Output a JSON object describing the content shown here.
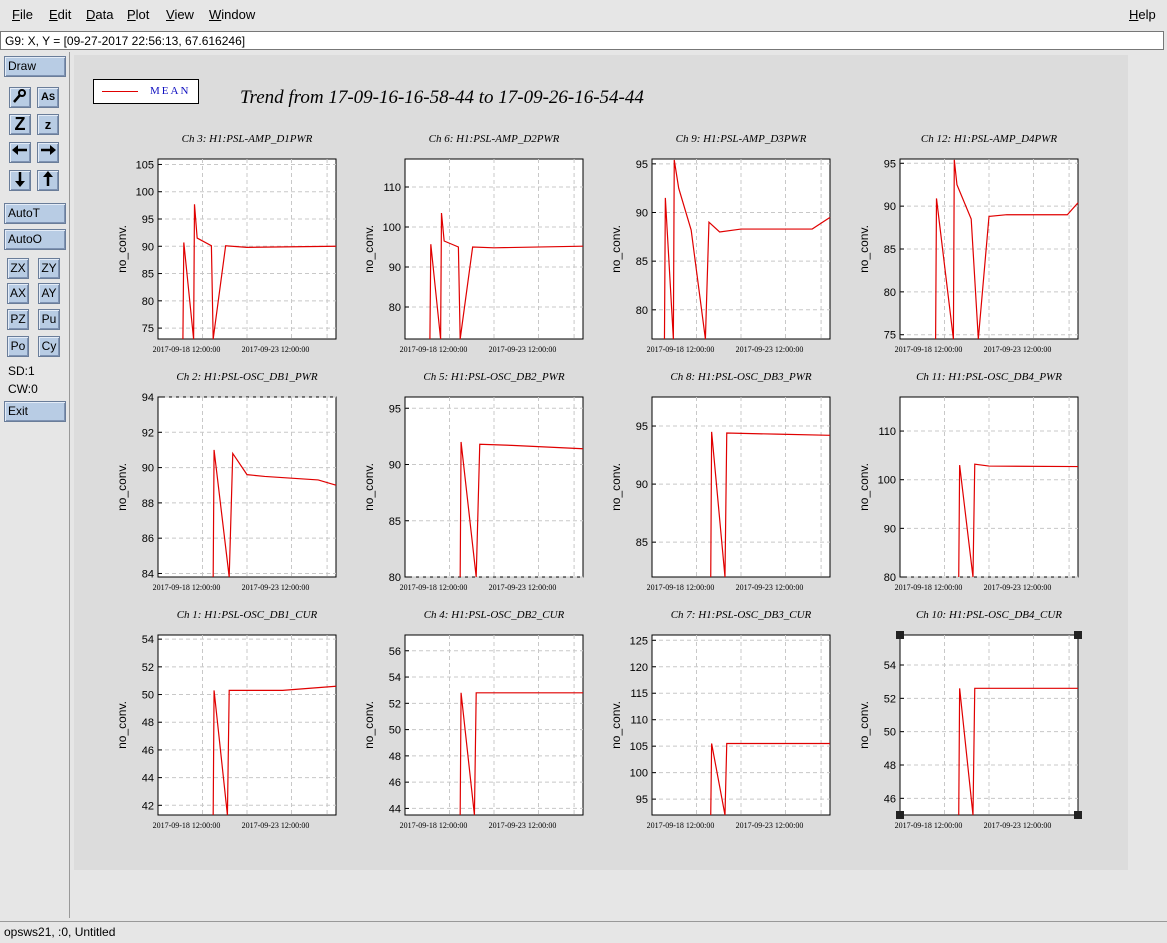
{
  "menubar": {
    "items": [
      {
        "label": "File",
        "key": "F",
        "rest": "ile",
        "name": "menu-file"
      },
      {
        "label": "Edit",
        "key": "E",
        "rest": "dit",
        "name": "menu-edit"
      },
      {
        "label": "Data",
        "key": "D",
        "rest": "ata",
        "name": "menu-data"
      },
      {
        "label": "Plot",
        "key": "P",
        "rest": "lot",
        "name": "menu-plot"
      },
      {
        "label": "View",
        "key": "V",
        "rest": "iew",
        "name": "menu-view"
      },
      {
        "label": "Window",
        "key": "W",
        "rest": "indow",
        "name": "menu-window"
      }
    ],
    "help": {
      "key": "H",
      "rest": "elp"
    }
  },
  "coord_readout": "G9: X, Y = [09-27-2017 22:56:13, 67.616246]",
  "toolbar": {
    "draw": "Draw",
    "autoT": "AutoT",
    "autoO": "AutoO",
    "pairs": [
      [
        "ZX",
        "ZY"
      ],
      [
        "AX",
        "AY"
      ],
      [
        "PZ",
        "Pu"
      ],
      [
        "Po",
        "Cy"
      ]
    ],
    "sd": "SD:1",
    "cw": "CW:0",
    "exit": "Exit",
    "icons": [
      "search-icon",
      "text-size-icon",
      "zoom-in-icon",
      "zoom-out-icon",
      "arrow-left-icon",
      "arrow-right-icon",
      "arrow-down-icon",
      "arrow-up-icon"
    ]
  },
  "legend": {
    "label": "MEAN",
    "color": "#e00000"
  },
  "trend_title": "Trend from 17-09-16-16-58-44 to 17-09-26-16-54-44",
  "status": "opsws21, :0, Untitled",
  "chart_data": [
    {
      "type": "line",
      "title": "Ch 3: H1:PSL-AMP_D1PWR",
      "ylabel": "no_conv.",
      "ylim": [
        73,
        106
      ],
      "yticks": [
        75,
        80,
        85,
        90,
        95,
        100,
        105
      ],
      "xticks": [
        "2017-09-18 12:00:00",
        "2017-09-23 12:00:00"
      ],
      "x": [
        0.14,
        0.145,
        0.2,
        0.205,
        0.22,
        0.3,
        0.31,
        0.38,
        0.5,
        1.0
      ],
      "values": [
        73,
        90.7,
        73,
        97.7,
        91.5,
        90.1,
        73,
        90.1,
        89.8,
        90.0
      ]
    },
    {
      "type": "line",
      "title": "Ch 6: H1:PSL-AMP_D2PWR",
      "ylabel": "no_conv.",
      "ylim": [
        72,
        117
      ],
      "yticks": [
        80,
        90,
        100,
        110
      ],
      "xticks": [
        "2017-09-18 12:00:00",
        "2017-09-23 12:00:00"
      ],
      "x": [
        0.14,
        0.145,
        0.2,
        0.205,
        0.22,
        0.3,
        0.31,
        0.38,
        0.5,
        1.0
      ],
      "values": [
        72,
        95.7,
        72,
        103.5,
        96.5,
        95,
        72,
        95,
        94.8,
        95.2
      ]
    },
    {
      "type": "line",
      "title": "Ch 9: H1:PSL-AMP_D3PWR",
      "ylabel": "no_conv.",
      "ylim": [
        77,
        95.5
      ],
      "yticks": [
        80,
        85,
        90,
        95
      ],
      "xticks": [
        "2017-09-18 12:00:00",
        "2017-09-23 12:00:00"
      ],
      "x": [
        0.07,
        0.075,
        0.12,
        0.125,
        0.15,
        0.22,
        0.3,
        0.32,
        0.38,
        0.5,
        0.9,
        1.0
      ],
      "values": [
        77,
        91.5,
        77,
        95.4,
        92.5,
        88.2,
        77,
        89,
        88,
        88.3,
        88.3,
        89.5
      ]
    },
    {
      "type": "line",
      "title": "Ch 12: H1:PSL-AMP_D4PWR",
      "ylabel": "no_conv.",
      "ylim": [
        74.5,
        95.5
      ],
      "yticks": [
        75,
        80,
        85,
        90,
        95
      ],
      "xticks": [
        "2017-09-18 12:00:00",
        "2017-09-23 12:00:00"
      ],
      "x": [
        0.2,
        0.205,
        0.3,
        0.305,
        0.32,
        0.4,
        0.44,
        0.5,
        0.6,
        0.94,
        1.0
      ],
      "values": [
        74.5,
        90.9,
        74.5,
        95.4,
        92.5,
        88.5,
        74.5,
        88.8,
        89,
        89,
        90.4
      ]
    },
    {
      "type": "line",
      "title": "Ch 2: H1:PSL-OSC_DB1_PWR",
      "ylabel": "no_conv.",
      "ylim": [
        83.8,
        94
      ],
      "yticks": [
        84,
        86,
        88,
        90,
        92,
        94
      ],
      "xticks": [
        "2017-09-18 12:00:00",
        "2017-09-23 12:00:00"
      ],
      "x": [
        0.31,
        0.315,
        0.4,
        0.42,
        0.5,
        0.6,
        0.9,
        1.0
      ],
      "values": [
        83.8,
        91,
        83.8,
        90.8,
        89.6,
        89.5,
        89.3,
        89
      ]
    },
    {
      "type": "line",
      "title": "Ch 5: H1:PSL-OSC_DB2_PWR",
      "ylabel": "no_conv.",
      "ylim": [
        80,
        96
      ],
      "yticks": [
        80,
        85,
        90,
        95
      ],
      "xticks": [
        "2017-09-18 12:00:00",
        "2017-09-23 12:00:00"
      ],
      "x": [
        0.31,
        0.315,
        0.4,
        0.42,
        0.6,
        1.0
      ],
      "values": [
        80,
        92,
        80,
        91.8,
        91.7,
        91.4
      ]
    },
    {
      "type": "line",
      "title": "Ch 8: H1:PSL-OSC_DB3_PWR",
      "ylabel": "no_conv.",
      "ylim": [
        82,
        97.5
      ],
      "yticks": [
        85,
        90,
        95
      ],
      "xticks": [
        "2017-09-18 12:00:00",
        "2017-09-23 12:00:00"
      ],
      "x": [
        0.33,
        0.335,
        0.41,
        0.42,
        0.7,
        1.0
      ],
      "values": [
        82,
        94.5,
        82,
        94.4,
        94.3,
        94.2
      ]
    },
    {
      "type": "line",
      "title": "Ch 11: H1:PSL-OSC_DB4_PWR",
      "ylabel": "no_conv.",
      "ylim": [
        80,
        117
      ],
      "yticks": [
        80,
        90,
        100,
        110
      ],
      "xticks": [
        "2017-09-18 12:00:00",
        "2017-09-23 12:00:00"
      ],
      "x": [
        0.33,
        0.335,
        0.41,
        0.42,
        0.5,
        1.0
      ],
      "values": [
        80,
        103,
        80,
        103.2,
        102.8,
        102.7
      ]
    },
    {
      "type": "line",
      "title": "Ch 1: H1:PSL-OSC_DB1_CUR",
      "ylabel": "no_conv.",
      "ylim": [
        41.3,
        54.3
      ],
      "yticks": [
        42,
        44,
        46,
        48,
        50,
        52,
        54
      ],
      "xticks": [
        "2017-09-18 12:00:00",
        "2017-09-23 12:00:00"
      ],
      "x": [
        0.31,
        0.315,
        0.39,
        0.4,
        0.7,
        1.0
      ],
      "values": [
        41.3,
        50.3,
        41.3,
        50.3,
        50.3,
        50.6
      ]
    },
    {
      "type": "line",
      "title": "Ch 4: H1:PSL-OSC_DB2_CUR",
      "ylabel": "no_conv.",
      "ylim": [
        43.5,
        57.2
      ],
      "yticks": [
        44,
        46,
        48,
        50,
        52,
        54,
        56
      ],
      "xticks": [
        "2017-09-18 12:00:00",
        "2017-09-23 12:00:00"
      ],
      "x": [
        0.31,
        0.315,
        0.39,
        0.4,
        0.7,
        1.0
      ],
      "values": [
        43.5,
        52.8,
        43.5,
        52.8,
        52.8,
        52.8
      ]
    },
    {
      "type": "line",
      "title": "Ch 7: H1:PSL-OSC_DB3_CUR",
      "ylabel": "no_conv.",
      "ylim": [
        92,
        126
      ],
      "yticks": [
        95,
        100,
        105,
        110,
        115,
        120,
        125
      ],
      "xticks": [
        "2017-09-18 12:00:00",
        "2017-09-23 12:00:00"
      ],
      "x": [
        0.33,
        0.335,
        0.41,
        0.42,
        0.7,
        1.0
      ],
      "values": [
        92,
        105.5,
        92,
        105.5,
        105.5,
        105.5
      ]
    },
    {
      "type": "line",
      "title": "Ch 10: H1:PSL-OSC_DB4_CUR",
      "ylabel": "no_conv.",
      "ylim": [
        45,
        55.8
      ],
      "yticks": [
        46,
        48,
        50,
        52,
        54
      ],
      "xticks": [
        "2017-09-18 12:00:00",
        "2017-09-23 12:00:00"
      ],
      "x": [
        0.33,
        0.335,
        0.41,
        0.42,
        0.7,
        1.0
      ],
      "values": [
        45,
        52.6,
        45,
        52.6,
        52.6,
        52.6
      ]
    }
  ]
}
